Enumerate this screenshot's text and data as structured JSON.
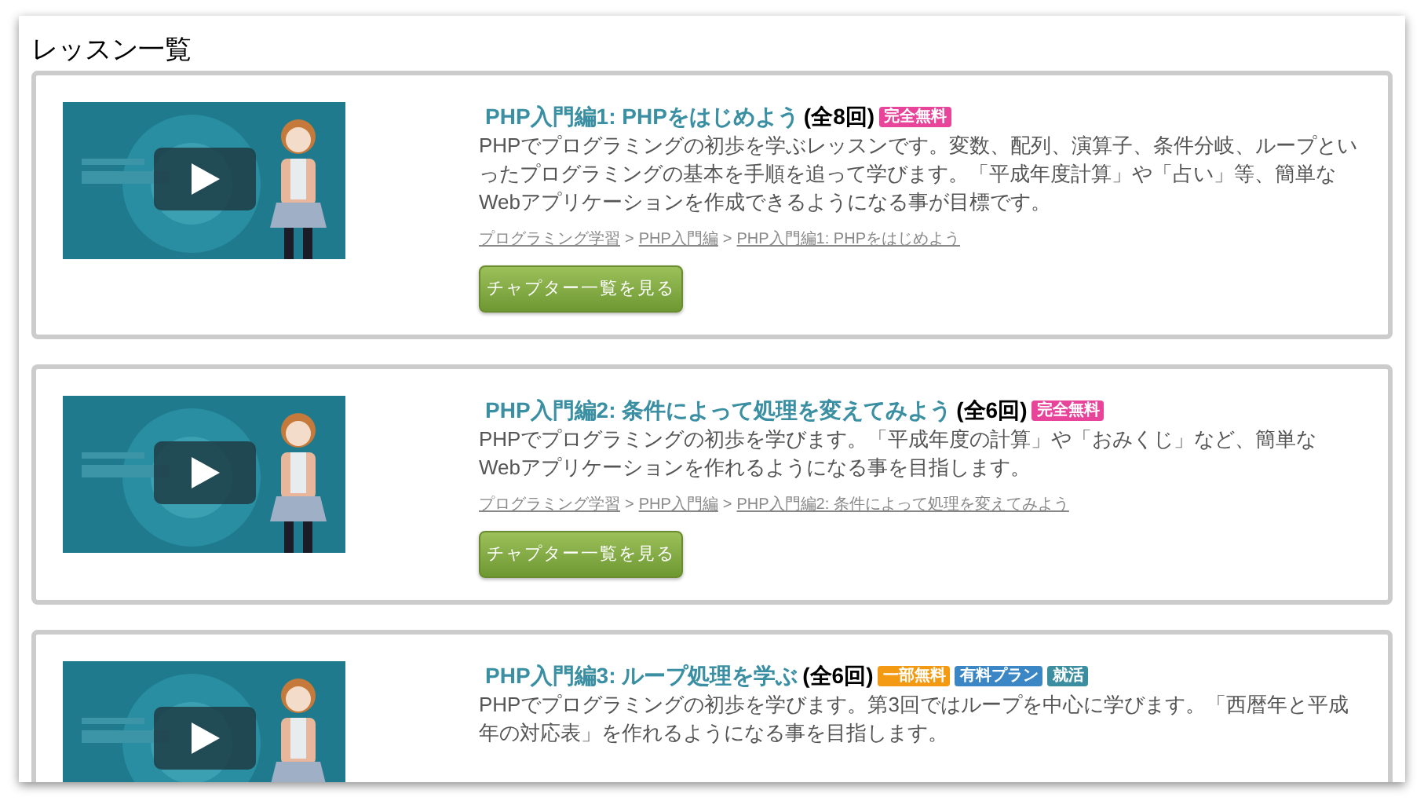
{
  "heading": "レッスン一覧",
  "lessons": [
    {
      "title": "PHP入門編1: PHPをはじめよう",
      "count": "(全8回)",
      "badges": [
        {
          "label": "完全無料",
          "color": "#e8449a"
        }
      ],
      "description": "PHPでプログラミングの初歩を学ぶレッスンです。変数、配列、演算子、条件分岐、ループといったプログラミングの基本を手順を追って学びます。「平成年度計算」や「占い」等、簡単なWebアプリケーションを作成できるようになる事が目標です。",
      "breadcrumb": [
        "プログラミング学習",
        "PHP入門編",
        "PHP入門編1: PHPをはじめよう"
      ],
      "separator": ">",
      "button": "チャプター一覧を見る"
    },
    {
      "title": "PHP入門編2: 条件によって処理を変えてみよう",
      "count": "(全6回)",
      "badges": [
        {
          "label": "完全無料",
          "color": "#e8449a"
        }
      ],
      "description": "PHPでプログラミングの初歩を学びます。「平成年度の計算」や「おみくじ」など、簡単なWebアプリケーションを作れるようになる事を目指します。",
      "breadcrumb": [
        "プログラミング学習",
        "PHP入門編",
        "PHP入門編2: 条件によって処理を変えてみよう"
      ],
      "separator": ">",
      "button": "チャプター一覧を見る"
    },
    {
      "title": "PHP入門編3: ループ処理を学ぶ",
      "count": "(全6回)",
      "badges": [
        {
          "label": "一部無料",
          "color": "#f39a12"
        },
        {
          "label": "有料プラン",
          "color": "#3b86c4"
        },
        {
          "label": "就活",
          "color": "#3a8ea0"
        }
      ],
      "description": "PHPでプログラミングの初歩を学びます。第3回ではループを中心に学びます。「西暦年と平成年の対応表」を作れるようになる事を目指します。"
    }
  ]
}
